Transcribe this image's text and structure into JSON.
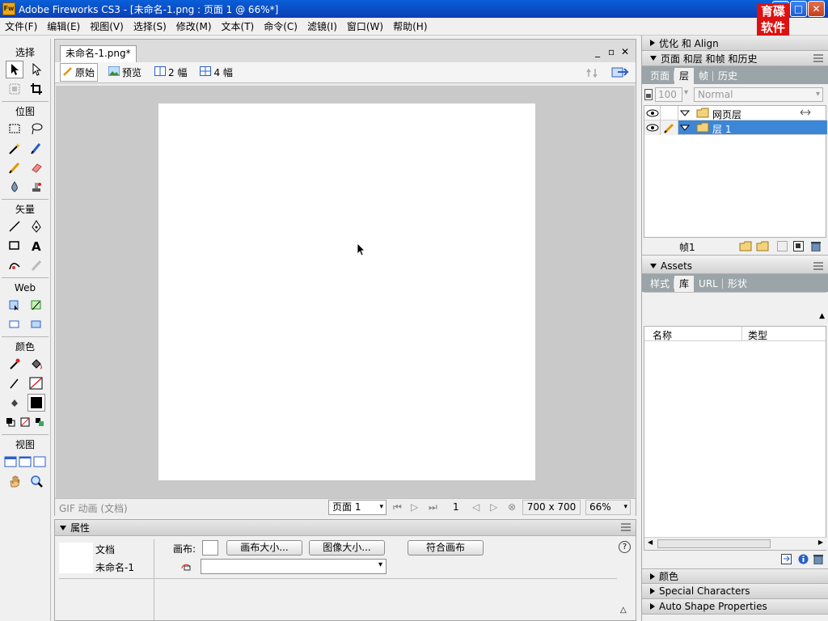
{
  "window": {
    "app_icon": "Fw",
    "title": "Adobe Fireworks CS3 - [未命名-1.png : 页面 1 @  66%*]",
    "minimize": "_",
    "maximize": "□",
    "close": "✕"
  },
  "watermark": {
    "line1": "育碟",
    "line2": "软件"
  },
  "menu": [
    "文件(F)",
    "编辑(E)",
    "视图(V)",
    "选择(S)",
    "修改(M)",
    "文本(T)",
    "命令(C)",
    "滤镜(I)",
    "窗口(W)",
    "帮助(H)"
  ],
  "toolbox": {
    "select": "选择",
    "bitmap": "位图",
    "vector": "矢量",
    "web": "Web",
    "colors": "颜色",
    "view": "视图"
  },
  "document": {
    "tab": "未命名-1.png*",
    "views": [
      "原始",
      "预览",
      "2 幅",
      "4 幅"
    ],
    "status_type": "GIF 动画 (文档)",
    "page_select": "页面 1",
    "frame_number": "1",
    "dimensions": "700 x 700",
    "zoom": "66%"
  },
  "properties": {
    "header": "属性",
    "doc_label": "文档",
    "doc_name": "未命名-1",
    "canvas_label": "画布:",
    "canvas_size_btn": "画布大小...",
    "image_size_btn": "图像大小...",
    "fit_canvas_btn": "符合画布",
    "help": "?"
  },
  "right_panels": {
    "optimize": "优化 和 Align",
    "pages_layers": "页面 和层 和帧 和历史",
    "tabs_top": [
      "页面",
      "层",
      "帧",
      "历史"
    ],
    "opacity": "100",
    "blend_mode": "Normal",
    "layers": [
      {
        "name": "网页层"
      },
      {
        "name": "层 1"
      }
    ],
    "frame_label": "帧1",
    "assets": "Assets",
    "tabs_assets": [
      "样式",
      "库",
      "URL",
      "形状"
    ],
    "lib_columns": [
      "名称",
      "类型"
    ],
    "collapsed": [
      "颜色",
      "Special Characters",
      "Auto Shape Properties"
    ]
  },
  "colors": {
    "title_bar": "#0b47c0",
    "selected_layer": "#3c86d8",
    "canvas_bg": "#c9c9c9"
  }
}
